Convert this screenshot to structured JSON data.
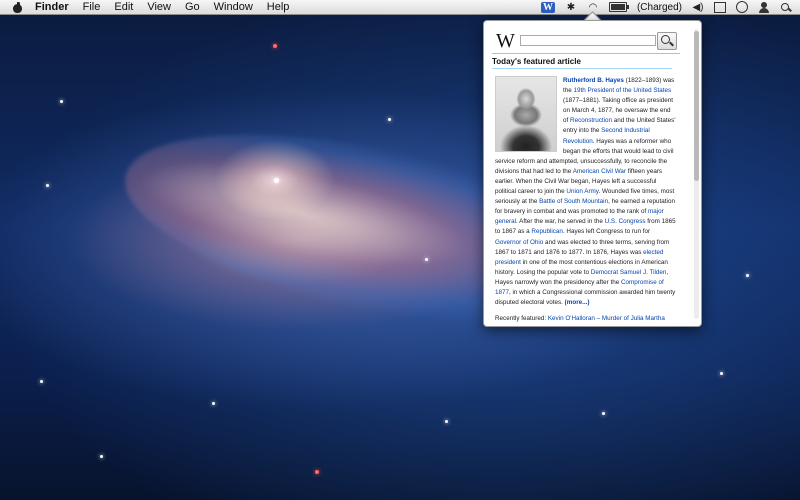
{
  "menubar": {
    "items": [
      "Finder",
      "File",
      "Edit",
      "View",
      "Go",
      "Window",
      "Help"
    ],
    "status": {
      "wiki_icon_letter": "W",
      "battery_text": "(Charged)",
      "battery_level": 1.0
    }
  },
  "popover": {
    "logo": "W",
    "search_value": "",
    "section_title": "Today's featured article",
    "article": {
      "subject": "Rutherford B. Hayes",
      "t1": " (1822–1893) was the ",
      "l1": "19th President of the United States",
      "t2": " (1877–1881). Taking office as president on March 4, 1877, he oversaw the end of ",
      "l2": "Reconstruction",
      "t3": " and the United States' entry into the ",
      "l3": "Second Industrial Revolution",
      "t4": ". Hayes was a reformer who began the efforts that would lead to civil service reform and attempted, unsuccessfully, to reconcile the divisions that had led to the ",
      "l4": "American Civil War",
      "t5": " fifteen years earlier. When the Civil War began, Hayes left a successful political career to join the ",
      "l5": "Union Army",
      "t6": ". Wounded five times, most seriously at the ",
      "l6": "Battle of South Mountain",
      "t7": ", he earned a reputation for bravery in combat and was promoted to the rank of ",
      "l7": "major general",
      "t8": ". After the war, he served in the ",
      "l8": "U.S. Congress",
      "t9": " from 1865 to 1867 as a ",
      "l9": "Republican",
      "t10": ". Hayes left Congress to run for ",
      "l10": "Governor of Ohio",
      "t11": " and was elected to three terms, serving from 1867 to 1871 and 1876 to 1877. In 1876, Hayes was ",
      "l11": "elected president",
      "t12": " in one of the most contentious elections in American history. Losing the popular vote to ",
      "l12": "Democrat Samuel J. Tilden",
      "t13": ", Hayes narrowly won the presidency after the ",
      "l13": "Compromise of 1877",
      "t14": ", in which a Congressional commission awarded him twenty disputed electoral votes. ",
      "more": "(more...)"
    },
    "recent_label": "Recently featured: ",
    "recent_link": "Kevin O'Halloran – Murder of Julia Martha"
  },
  "colors": {
    "link": "#0645ad",
    "desktop": "#0f2a62"
  }
}
